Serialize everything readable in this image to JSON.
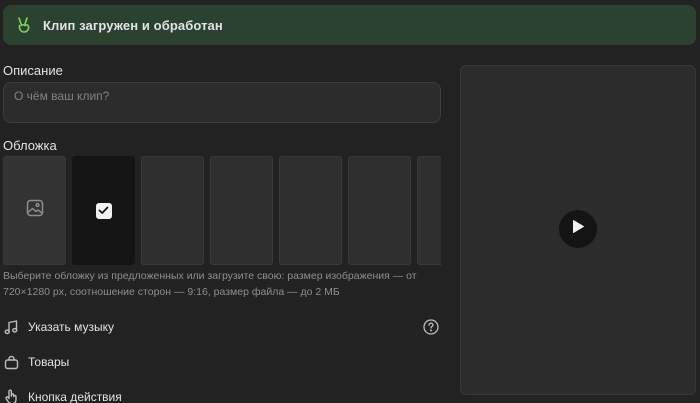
{
  "banner": {
    "text": "Клип загружен и обработан",
    "icon": "peace-hand-icon",
    "accent_color": "#7fd05f"
  },
  "description": {
    "title": "Описание",
    "placeholder": "О чём ваш клип?",
    "value": ""
  },
  "cover": {
    "title": "Обложка",
    "items": [
      {
        "kind": "upload",
        "icon": "image-icon",
        "selected": false
      },
      {
        "kind": "frame",
        "selected": true
      },
      {
        "kind": "frame",
        "selected": false
      },
      {
        "kind": "frame",
        "selected": false
      },
      {
        "kind": "frame",
        "selected": false
      },
      {
        "kind": "frame",
        "selected": false
      },
      {
        "kind": "frame",
        "selected": false
      }
    ],
    "hint": "Выберите обложку из предложенных или загрузите свою: размер изображения — от 720×1280 px, соотношение сторон — 9:16, размер файла — до 2 МБ"
  },
  "options": [
    {
      "label": "Указать музыку",
      "icon": "music-note-icon",
      "help": true
    },
    {
      "label": "Товары",
      "icon": "shopping-bag-icon",
      "help": false
    },
    {
      "label": "Кнопка действия",
      "icon": "hand-pointer-icon",
      "help": false
    }
  ],
  "preview": {
    "play_icon": "play-icon"
  }
}
